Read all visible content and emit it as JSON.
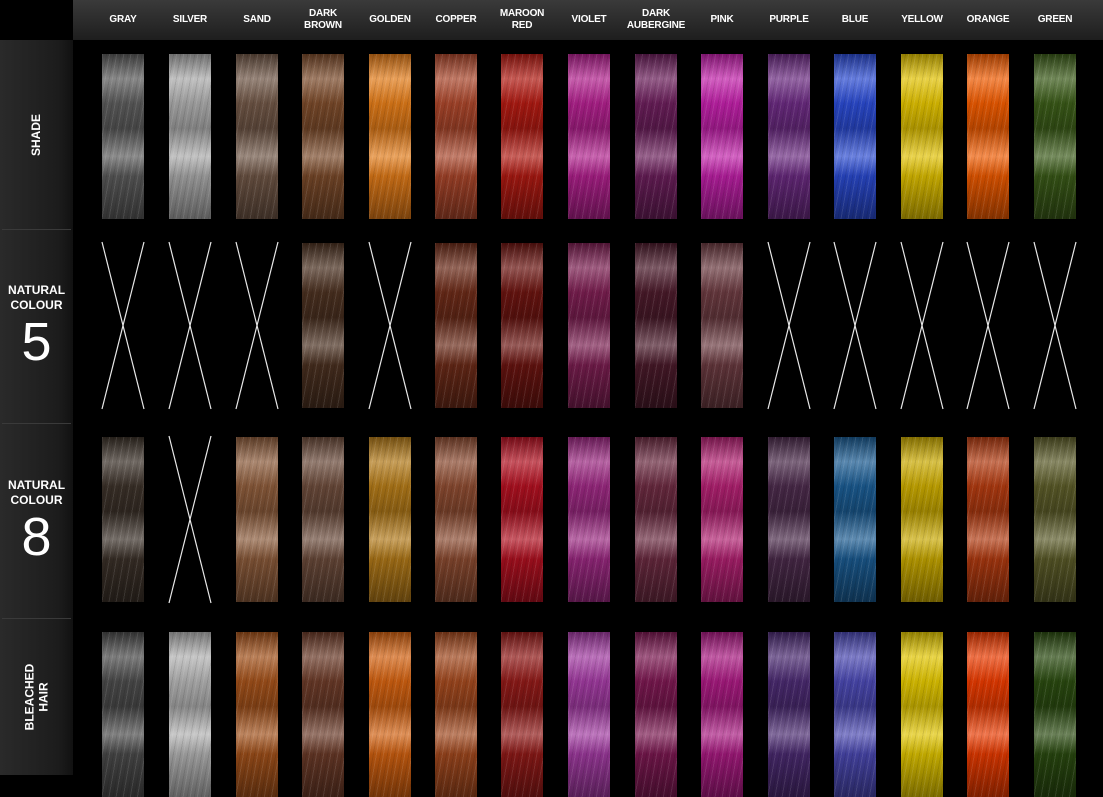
{
  "columns": [
    {
      "label": "GRAY"
    },
    {
      "label": "SILVER"
    },
    {
      "label": "SAND"
    },
    {
      "label": "DARK BROWN"
    },
    {
      "label": "GOLDEN"
    },
    {
      "label": "COPPER"
    },
    {
      "label": "MAROON RED"
    },
    {
      "label": "VIOLET"
    },
    {
      "label": "DARK AUBERGINE"
    },
    {
      "label": "PINK"
    },
    {
      "label": "PURPLE"
    },
    {
      "label": "BLUE"
    },
    {
      "label": "YELLOW"
    },
    {
      "label": "ORANGE"
    },
    {
      "label": "GREEN"
    }
  ],
  "rows": [
    {
      "label": "SHADE",
      "swatches": [
        "#5a5a5a",
        "#a8a8a8",
        "#6e5545",
        "#7a4a2a",
        "#e07a18",
        "#a8452a",
        "#b01a12",
        "#b0208c",
        "#6a1e5a",
        "#c020a8",
        "#6a2a80",
        "#2a4ad0",
        "#e0c000",
        "#ee5a00",
        "#3a5a18"
      ]
    },
    {
      "label": "NATURAL COLOUR",
      "number": "5",
      "swatches": [
        null,
        null,
        null,
        "#4a3020",
        null,
        "#6a2a18",
        "#6a1410",
        "#7a1e50",
        "#4a1a2a",
        "#6a3a40",
        null,
        null,
        null,
        null,
        null
      ]
    },
    {
      "label": "NATURAL COLOUR",
      "number": "8",
      "swatches": [
        "#3a3028",
        null,
        "#8a5a3a",
        "#6a4a3a",
        "#b07818",
        "#8a4a30",
        "#b01020",
        "#9a2880",
        "#6a2a40",
        "#b02070",
        "#4a2a4a",
        "#1a5a90",
        "#c8a800",
        "#b03a10",
        "#5a5a28"
      ]
    },
    {
      "label": "BLEACHED HAIR",
      "swatches": [
        "#4a4a4a",
        "#b0b0b0",
        "#a0501a",
        "#6a3a28",
        "#d06010",
        "#a0481e",
        "#901a18",
        "#a03aa0",
        "#7a1850",
        "#a81a80",
        "#4a2a70",
        "#4a48b0",
        "#e0c400",
        "#e83a00",
        "#2a4a10"
      ]
    }
  ]
}
